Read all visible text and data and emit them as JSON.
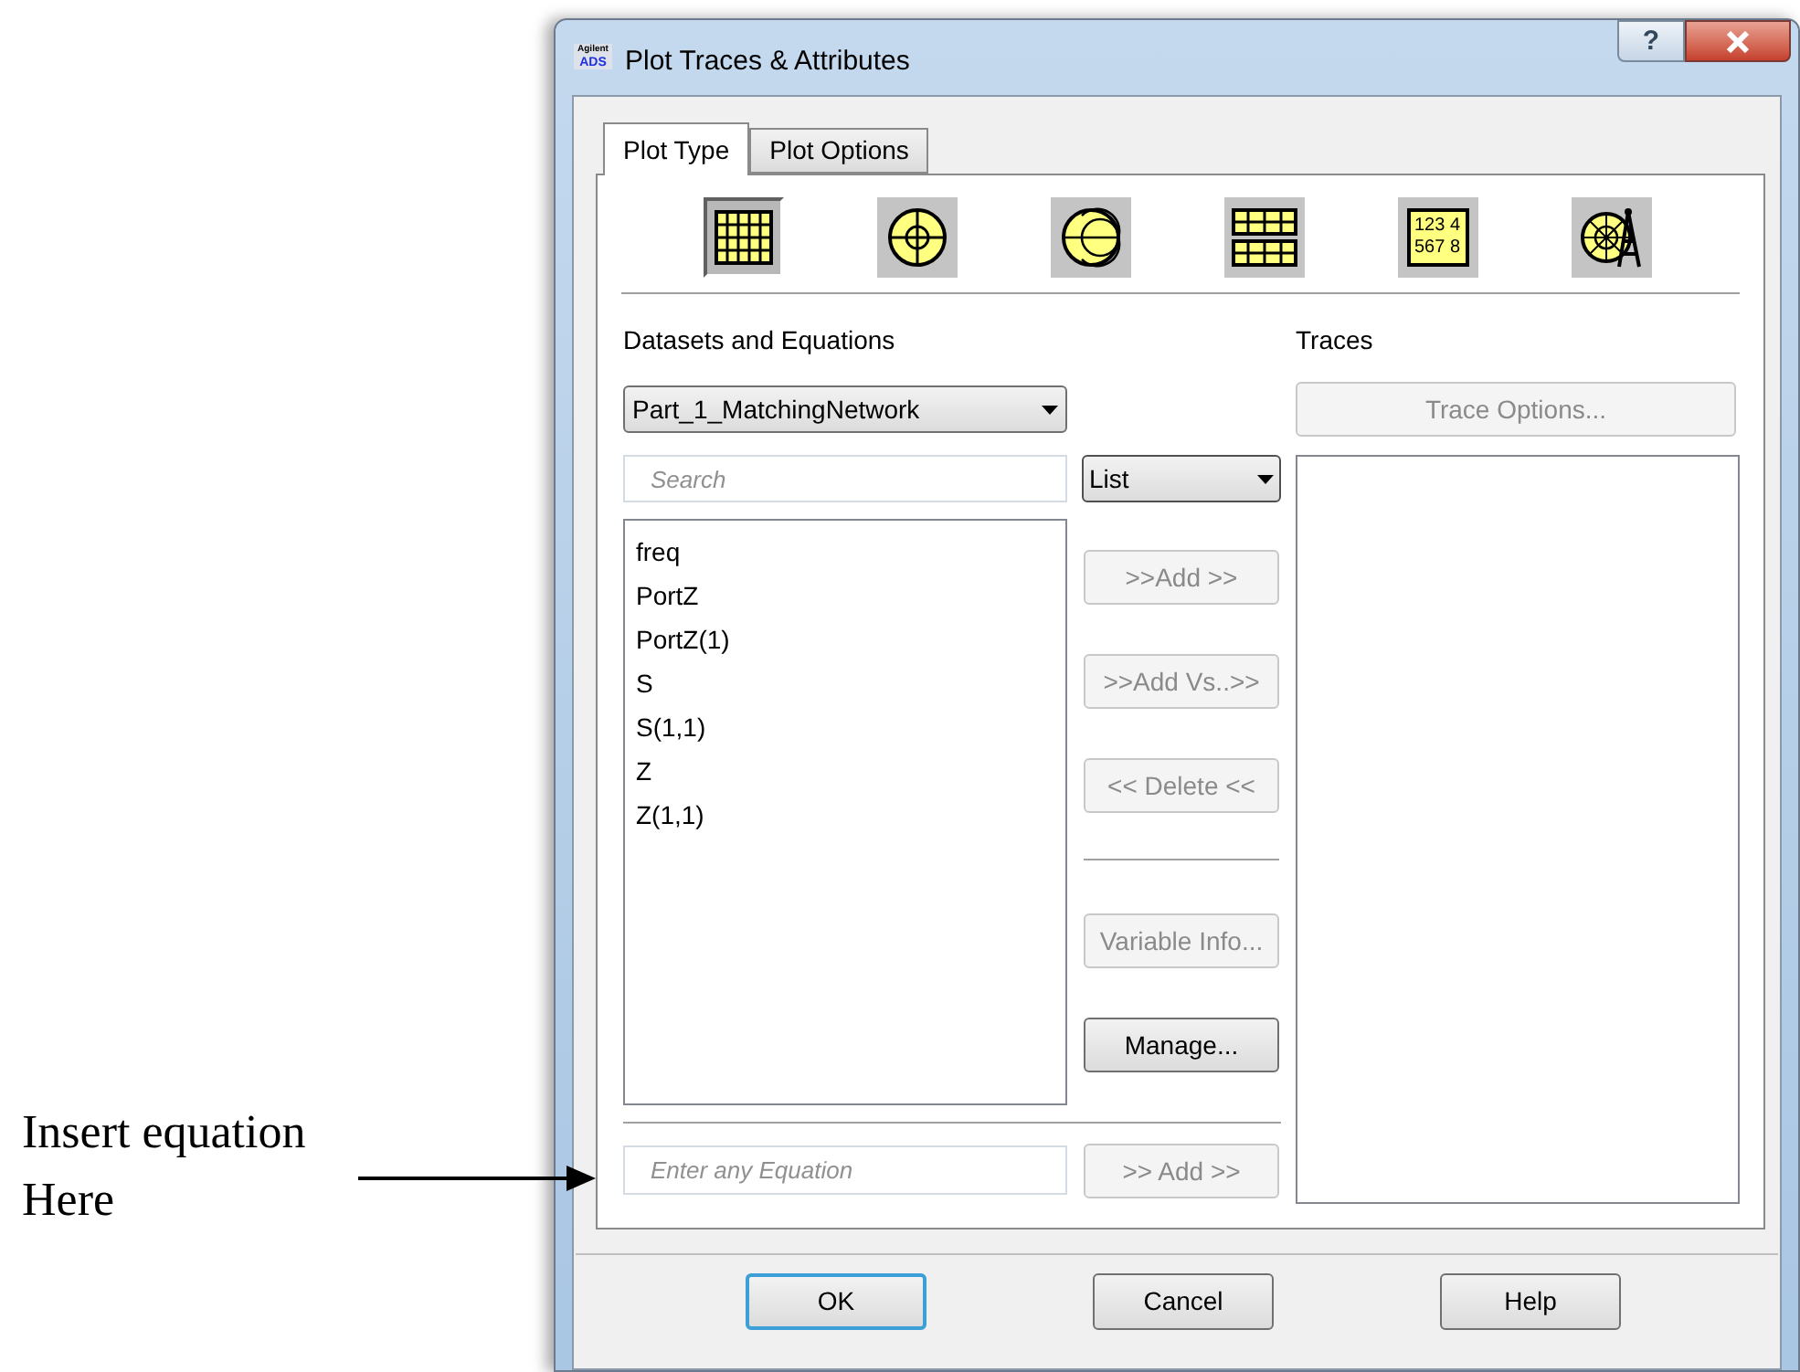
{
  "annotation": {
    "text": "Insert equation Here"
  },
  "window": {
    "logo": [
      "Agilent",
      "ADS"
    ],
    "title": "Plot Traces & Attributes",
    "help_button": "?"
  },
  "tabs": [
    {
      "label": "Plot Type",
      "selected": true
    },
    {
      "label": "Plot Options",
      "selected": false
    }
  ],
  "plot_types": [
    {
      "kind": "rectangular",
      "selected": true
    },
    {
      "kind": "polar",
      "selected": false
    },
    {
      "kind": "smith",
      "selected": false
    },
    {
      "kind": "stacked",
      "selected": false
    },
    {
      "kind": "list",
      "selected": false,
      "lines": [
        "123 4",
        "567 8"
      ]
    },
    {
      "kind": "antenna",
      "selected": false
    }
  ],
  "datasets": {
    "label": "Datasets and Equations",
    "dataset": "Part_1_MatchingNetwork",
    "search_placeholder": "Search",
    "view": "List",
    "variables": [
      "freq",
      "PortZ",
      "PortZ(1)",
      "S",
      "S(1,1)",
      "Z",
      "Z(1,1)"
    ],
    "equation_placeholder": "Enter any Equation",
    "equation_add": {
      "label": ">> Add >>",
      "disabled": true
    }
  },
  "actions": [
    {
      "label": ">>Add >>",
      "disabled": true
    },
    {
      "label": ">>Add Vs..>>",
      "disabled": true
    },
    {
      "label": "<< Delete <<",
      "disabled": true
    },
    {
      "label": "Variable Info...",
      "disabled": true
    },
    {
      "label": "Manage...",
      "disabled": false
    }
  ],
  "traces": {
    "label": "Traces",
    "options_button": {
      "label": "Trace Options...",
      "disabled": true
    }
  },
  "dialog_buttons": [
    {
      "label": "OK",
      "default": true
    },
    {
      "label": "Cancel",
      "default": false
    },
    {
      "label": "Help",
      "default": false
    }
  ]
}
